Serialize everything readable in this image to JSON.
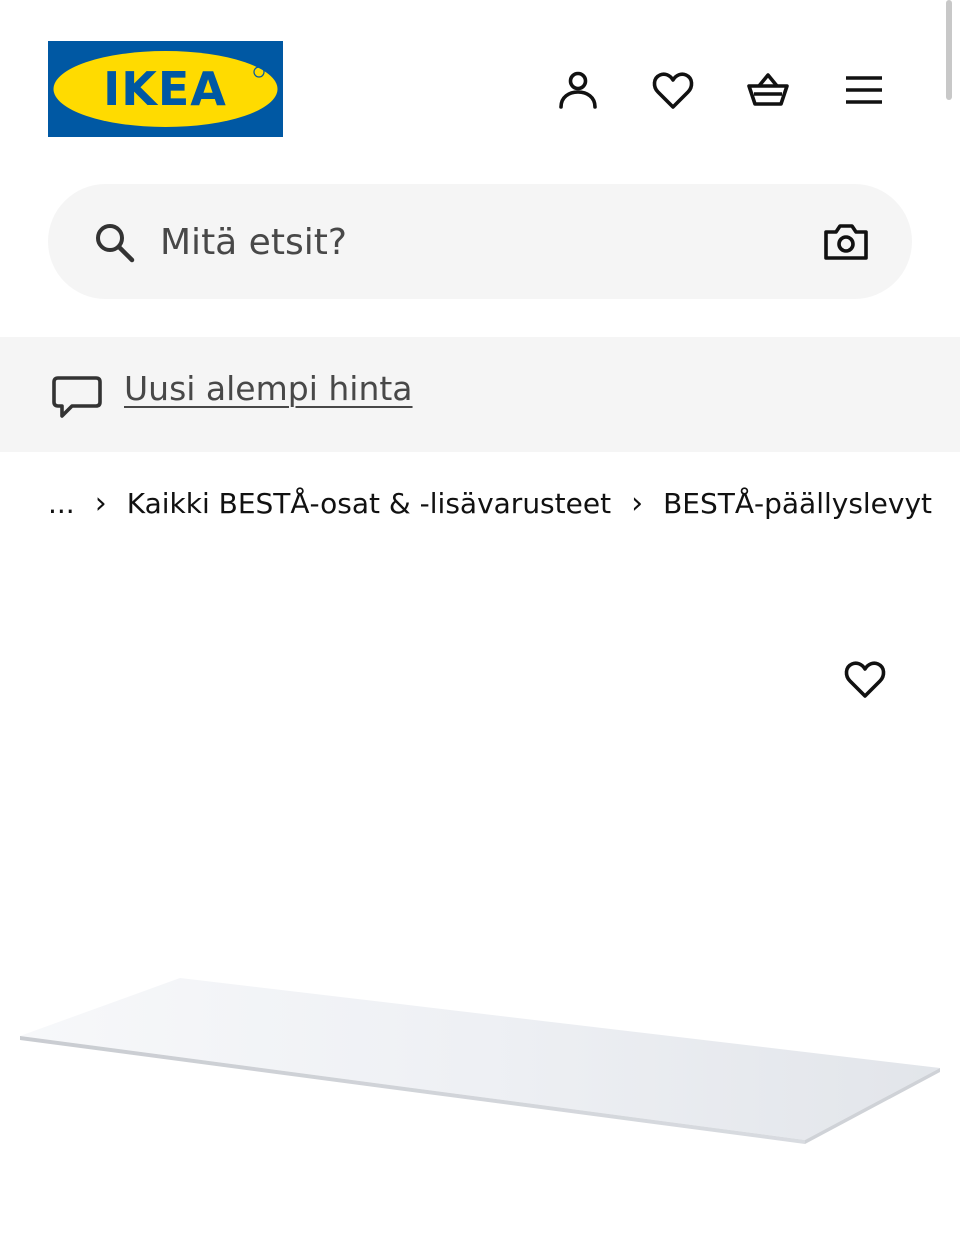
{
  "header": {
    "logo_text": "IKEA",
    "logo_colors": {
      "blue": "#0058a3",
      "yellow": "#ffdb00"
    },
    "icons": [
      "account-icon",
      "wishlist-icon",
      "cart-icon",
      "menu-icon"
    ]
  },
  "search": {
    "placeholder": "Mitä etsit?",
    "value": "",
    "icons": [
      "search-icon",
      "camera-icon"
    ]
  },
  "banner": {
    "icon": "chat-bubble-icon",
    "link_text": "Uusi alempi hinta"
  },
  "breadcrumb": {
    "ellipsis": "...",
    "items": [
      {
        "label": "Kaikki BESTÅ-osat & -lisävarusteet"
      },
      {
        "label": "BESTÅ-päällyslevyt"
      }
    ],
    "separator": "›"
  },
  "product": {
    "favourite_icon": "heart-icon",
    "image": "glass-top-panel"
  }
}
